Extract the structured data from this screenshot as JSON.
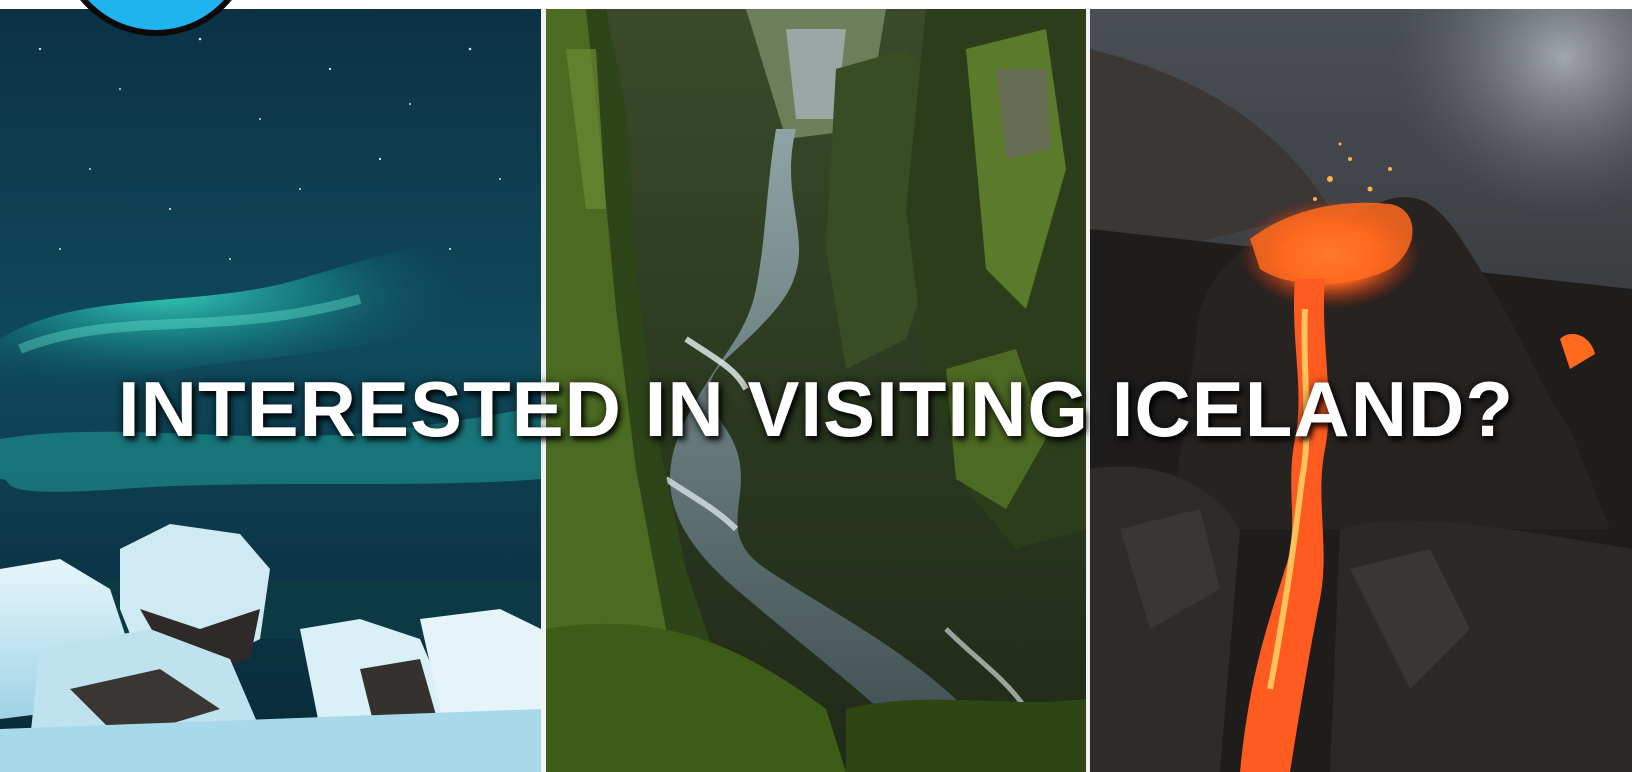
{
  "headline": {
    "text": "INTERESTED IN VISITING ICELAND?",
    "color": "#ffffff"
  },
  "logo": {
    "color": "#1fb4ee",
    "icon": "logo-badge"
  },
  "panels": [
    {
      "name": "aurora-panel",
      "subject": "northern-lights-over-snowy-rocks"
    },
    {
      "name": "canyon-panel",
      "subject": "mossy-canyon-with-river"
    },
    {
      "name": "volcano-panel",
      "subject": "erupting-volcano-with-lava"
    }
  ],
  "colors": {
    "aurora_sky": "#0b3c4e",
    "aurora_glow": "#2fd7c4",
    "moss": "#3f5e1e",
    "lava": "#ff5a1f",
    "rock": "#2a2826"
  }
}
